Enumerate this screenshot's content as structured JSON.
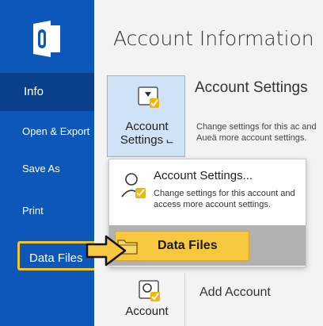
{
  "sidebar": {
    "logo_icon": "outlook-logo-icon",
    "items": [
      {
        "label": "Info",
        "active": true
      },
      {
        "label": "Open & Export"
      },
      {
        "label": "Save As"
      },
      {
        "label": "Print"
      },
      {
        "label": "Data Files",
        "highlighted": true
      }
    ]
  },
  "main": {
    "title": "Account Information",
    "account_settings_tile": {
      "line1": "Account",
      "line2": "Settings ⨽",
      "icon": "account-settings-icon"
    },
    "account_settings_heading": "Account Settings",
    "account_settings_desc": "Change settings for this ac and Aueä more account settings.",
    "dropdown": {
      "item1_title": "Account Settings...",
      "item1_desc": "Change settings for this account and access more account settings.",
      "item1_icon": "person-check-icon",
      "item2_label": "Data Files",
      "item2_icon": "folder-icon"
    },
    "add_account_tile_label": "Account",
    "add_account_heading": "Add Account"
  },
  "colors": {
    "sidebar": "#0c57b8",
    "sidebar_active": "#0a3f8c",
    "highlight_yellow": "#f6c840",
    "tile_blue": "#cfe2f6"
  }
}
